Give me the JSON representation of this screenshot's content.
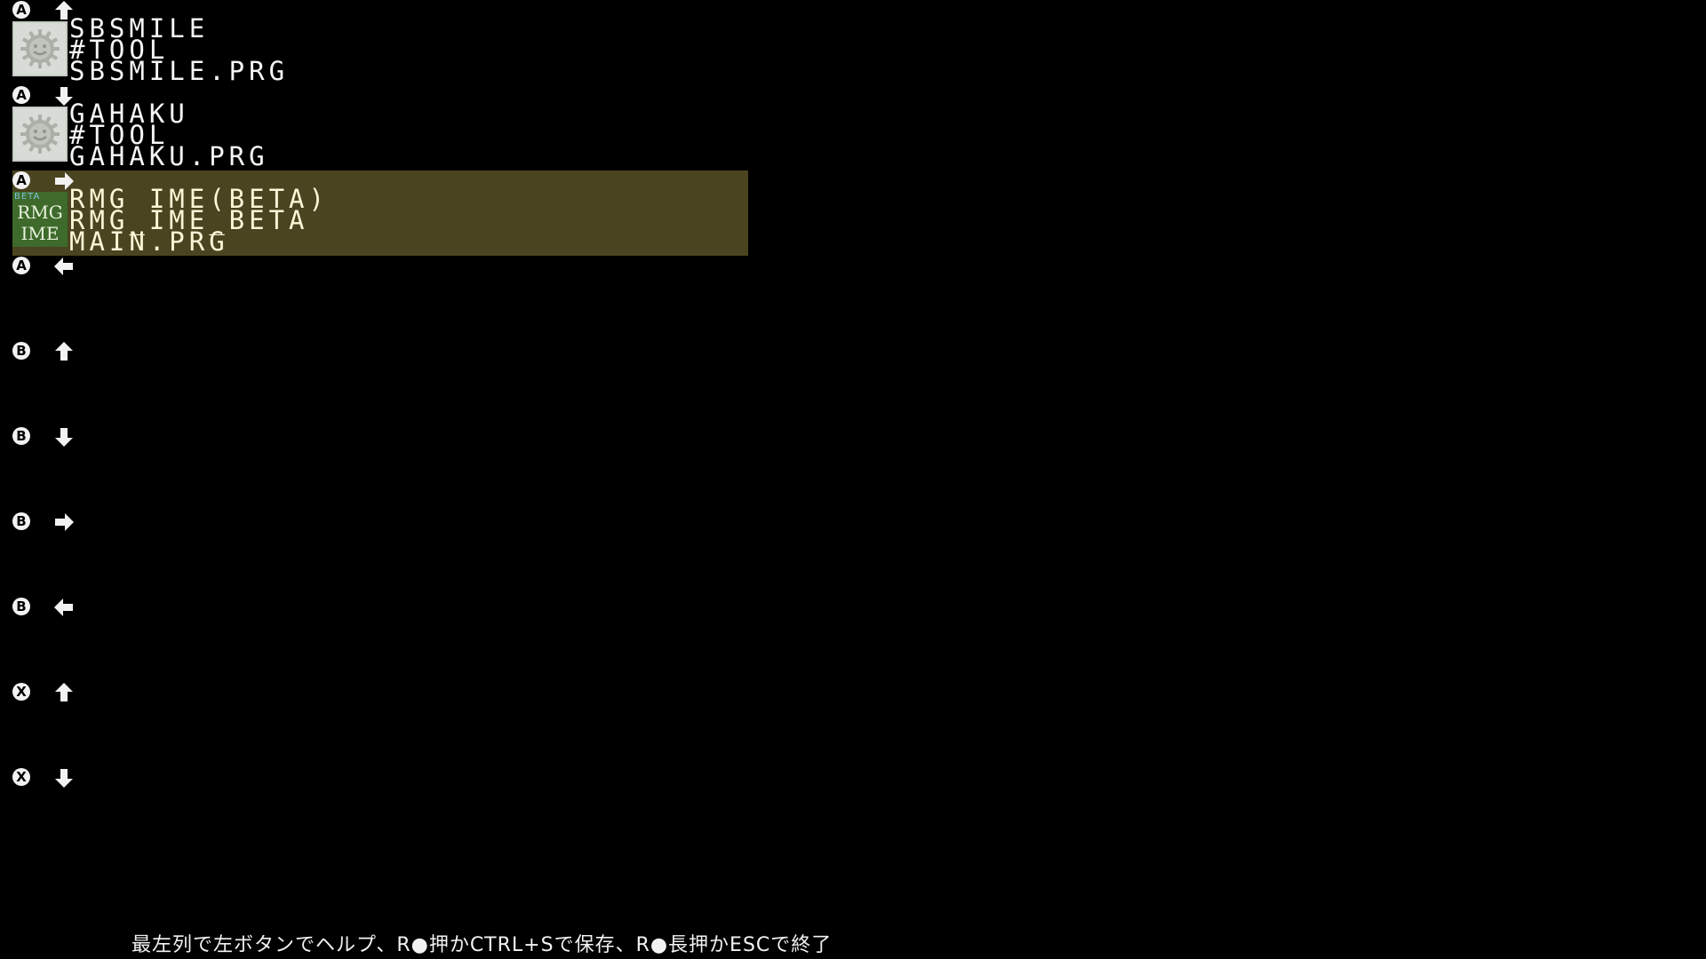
{
  "slots": [
    {
      "button": "A",
      "arrow": "up",
      "selected": false,
      "icon": "gear-icon",
      "name": "SBSMILE",
      "project": "#TOOL",
      "file": "SBSMILE.PRG"
    },
    {
      "button": "A",
      "arrow": "down",
      "selected": false,
      "icon": "gear-icon",
      "name": "GAHAKU",
      "project": "#TOOL",
      "file": "GAHAKU.PRG"
    },
    {
      "button": "A",
      "arrow": "right",
      "selected": true,
      "icon": "rmg-ime-icon",
      "name": "RMG IME(BETA)",
      "project": "RMG_IME_BETA",
      "file": "MAIN.PRG"
    },
    {
      "button": "A",
      "arrow": "left",
      "selected": false,
      "icon": "",
      "name": "",
      "project": "",
      "file": ""
    },
    {
      "button": "B",
      "arrow": "up",
      "selected": false,
      "icon": "",
      "name": "",
      "project": "",
      "file": ""
    },
    {
      "button": "B",
      "arrow": "down",
      "selected": false,
      "icon": "",
      "name": "",
      "project": "",
      "file": ""
    },
    {
      "button": "B",
      "arrow": "right",
      "selected": false,
      "icon": "",
      "name": "",
      "project": "",
      "file": ""
    },
    {
      "button": "B",
      "arrow": "left",
      "selected": false,
      "icon": "",
      "name": "",
      "project": "",
      "file": ""
    },
    {
      "button": "X",
      "arrow": "up",
      "selected": false,
      "icon": "",
      "name": "",
      "project": "",
      "file": ""
    },
    {
      "button": "X",
      "arrow": "down",
      "selected": false,
      "icon": "",
      "name": "",
      "project": "",
      "file": ""
    }
  ],
  "rmg_icon": {
    "top": "BETA",
    "line1": "RMG",
    "line2": "IME"
  },
  "footer": "最左列で左ボタンでヘルプ、R●押かCTRL+Sで保存、R●長押かESCで終了",
  "colors": {
    "background": "#000000",
    "selected_row": "#4b4420",
    "text": "#f6f6f6"
  }
}
